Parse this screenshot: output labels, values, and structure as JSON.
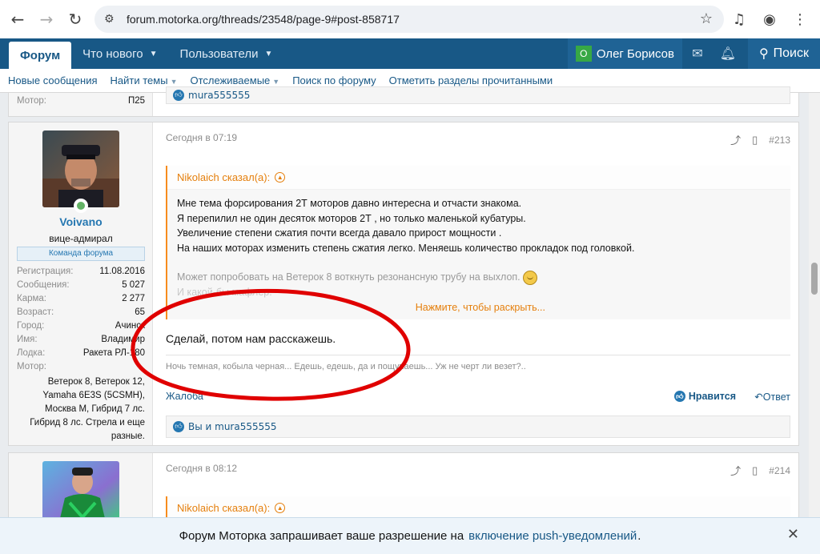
{
  "browser": {
    "url": "forum.motorka.org/threads/23548/page-9#post-858717"
  },
  "sitenav": {
    "forum": "Форум",
    "whats_new": "Что нового",
    "users": "Пользователи",
    "user_name": "Олег Борисов",
    "user_initial": "О",
    "search": "Поиск"
  },
  "subnav": {
    "items": [
      "Новые сообщения",
      "Найти темы",
      "Отслеживаемые",
      "Поиск по форуму",
      "Отметить разделы прочитанными"
    ]
  },
  "prev_post": {
    "motor_label": "Мотор:",
    "motor_value": "П25",
    "reactions": "mura555555"
  },
  "post1": {
    "username": "Voivano",
    "user_title": "вице-адмирал",
    "banner": "Команда форума",
    "stats": [
      {
        "k": "Регистрация:",
        "v": "11.08.2016"
      },
      {
        "k": "Сообщения:",
        "v": "5 027"
      },
      {
        "k": "Карма:",
        "v": "2 277"
      },
      {
        "k": "Возраст:",
        "v": "65"
      },
      {
        "k": "Город:",
        "v": "Ачинск"
      },
      {
        "k": "Имя:",
        "v": "Владимир"
      },
      {
        "k": "Лодка:",
        "v": "Ракета РЛ-180"
      },
      {
        "k": "Мотор:",
        "v": ""
      }
    ],
    "motor_lines": [
      "Ветерок 8, Ветерок 12,",
      "Yamaha 6E3S (5CSMH),",
      "Москва М, Гибрид 7 лс.",
      "Гибрид 8 лс. Стрела и еще",
      "разные."
    ],
    "date": "Сегодня в 07:19",
    "number": "#213",
    "quote_author": "Nikolaich сказал(а):",
    "quote_lines": [
      "Мне тема форсирования 2Т моторов давно интересна и отчасти знакома.",
      "Я перепилил не один десяток моторов 2Т , но только маленькой кубатуры.",
      "Увеличение степени сжатия почти всегда давало прирост мощности .",
      "На наших моторах изменить степень сжатия легко. Меняешь количество прокладок под головкой."
    ],
    "quote_fade_1": "Может попробовать на Ветерок 8 воткнуть резонансную трубу на выхлоп.",
    "quote_fade_2": "И какой-бы мафлер.",
    "expand": "Нажмите, чтобы раскрыть...",
    "message": "Сделай, потом нам расскажешь.",
    "signature": "Ночь темная, кобыла черная... Едешь, едешь, да и пощупаешь... Уж не черт ли везет?..",
    "report": "Жалоба",
    "like": "Нравится",
    "reply": "Ответ",
    "reactions": "Вы и mura555555"
  },
  "post2": {
    "date": "Сегодня в 08:12",
    "number": "#214",
    "quote_author": "Nikolaich сказал(а):"
  },
  "notification": {
    "text_before": "Форум Моторка запрашивает ваше разрешение на",
    "link": "включение push-уведомлений",
    "text_after": "."
  },
  "colors": {
    "nav": "#185886",
    "accent": "#2577b1",
    "quote": "#f78c1e",
    "annotation": "#e00000"
  }
}
